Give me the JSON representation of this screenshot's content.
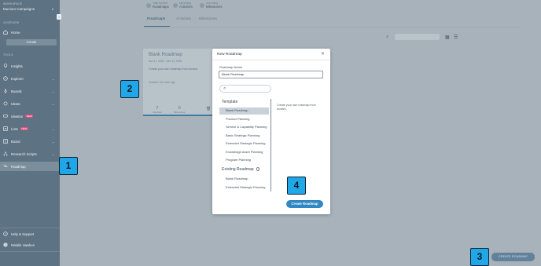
{
  "sidebar": {
    "workspace_label": "WORKSPACE",
    "workspace_name": "Munium Campaigns",
    "collapse_icon": "chevron-left-icon",
    "overview_label": "OVERVIEW",
    "home_label": "Home",
    "create_label": "Create",
    "tools_label": "TOOLS",
    "items": [
      {
        "label": "Insights",
        "icon": "lightbulb-icon",
        "badge": "",
        "chevron": false
      },
      {
        "label": "Explorer",
        "icon": "compass-icon",
        "badge": "",
        "chevron": true
      },
      {
        "label": "Boards",
        "icon": "rocket-icon",
        "badge": "",
        "chevron": true
      },
      {
        "label": "Ideate",
        "icon": "bulb-icon",
        "badge": "",
        "chevron": true
      },
      {
        "label": "Ideation",
        "icon": "chat-icon",
        "badge": "NEW",
        "chevron": false
      },
      {
        "label": "Lists",
        "icon": "list-icon",
        "badge": "NEW",
        "chevron": true
      },
      {
        "label": "Board",
        "icon": "board-icon",
        "badge": "",
        "chevron": true
      },
      {
        "label": "Research Scripts",
        "icon": "network-icon",
        "badge": "",
        "chevron": true
      },
      {
        "label": "Roadmap",
        "icon": "roadmap-icon",
        "badge": "",
        "chevron": false
      }
    ],
    "help_label": "Help & Support",
    "user_name": "Natalie Hawkes"
  },
  "top_stats": [
    {
      "label": "Total Number",
      "value": "Roadmaps"
    },
    {
      "label": "Upcoming",
      "value": "Activities"
    },
    {
      "label": "Upcoming",
      "value": "Milestones"
    }
  ],
  "tabs": [
    "Roadmaps",
    "Activities",
    "Milestones"
  ],
  "card": {
    "title": "Blank Roadmap",
    "dates": "Nov 17, 2026 - Dec 14, 2026",
    "description": "Create your own roadmap from scratch",
    "created": "Created: One hour ago",
    "stats": [
      {
        "value": "7",
        "label": "Activities"
      },
      {
        "value": "0",
        "label": "Milestones"
      }
    ]
  },
  "modal": {
    "title": "New Roadmap",
    "name_label": "Roadmap Name",
    "name_value": "Blank Roadmap",
    "search_placeholder": "",
    "template_heading": "Template",
    "templates": [
      "Blank Roadmap",
      "Product Planning",
      "Service & Capability Planning",
      "Basic Strategic Planning",
      "Extended Strategic Planning",
      "Knowledge Asset Planning",
      "Program Planning"
    ],
    "existing_heading": "Existing Roadmap",
    "existing": [
      "Blank Roadmap",
      "Extended Strategic Planning"
    ],
    "description": "Create your own roadmap from scratch.",
    "submit_label": "Create Roadmap"
  },
  "steps": [
    "1",
    "2",
    "3",
    "4"
  ],
  "cta_label": "CREATE ROADMAP",
  "colors": {
    "accent": "#2f88c4",
    "step_badge": "#1fa7e8",
    "sidebar": "#5d7282",
    "overlay": "#a7b2bb",
    "badge_new": "#e0527a"
  }
}
